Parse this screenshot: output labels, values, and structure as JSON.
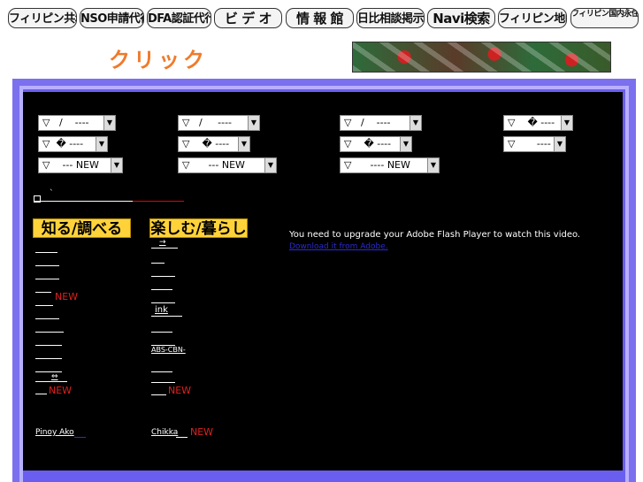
{
  "nav": [
    {
      "label": "フィリピン共和国"
    },
    {
      "label": "NSO申請代行"
    },
    {
      "label": "DFA認証代行"
    },
    {
      "label": "ビ デ オ"
    },
    {
      "label": "情 報 館"
    },
    {
      "label": "日比相談掲示板"
    },
    {
      "label": "Navi検索"
    },
    {
      "label": "フィリピン地図"
    },
    {
      "label": "フィリピン国内永住ビザ代行"
    }
  ],
  "logo_text": "クリック",
  "selects": [
    {
      "text": "▽   /    ----"
    },
    {
      "text": "▽   /     ----"
    },
    {
      "text": "▽   /    ----"
    },
    {
      "text": "▽    � ----"
    },
    {
      "text": "▽  � ----"
    },
    {
      "text": "▽    � ----"
    },
    {
      "text": "▽    � ----"
    },
    {
      "text": "▽       ----"
    },
    {
      "text": "▽    --- NEW"
    },
    {
      "text": "▽      --- NEW"
    },
    {
      "text": "▽      ---- NEW"
    }
  ],
  "section_left": "知る/調べる",
  "section_right": "楽しむ/暮らし",
  "left_links": {
    "arrow": "⇔",
    "pinoy": "Pinoy Ako",
    "new": "NEW"
  },
  "right_links": {
    "arrow": "→",
    "ink": "ink",
    "abs": "ABS-CBN-",
    "chikka": "Chikka",
    "new": "NEW"
  },
  "flash": {
    "message": "You need to upgrade your Adobe Flash Player to watch this video.",
    "link": "Download it from Adobe."
  }
}
